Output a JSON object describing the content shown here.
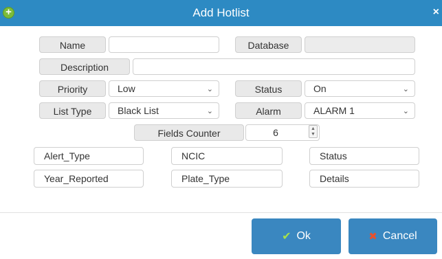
{
  "dialog": {
    "title": "Add Hotlist",
    "add_icon": "plus-circle-icon",
    "close_glyph": "×"
  },
  "form": {
    "name_label": "Name",
    "name_value": "",
    "database_label": "Database",
    "database_value": "",
    "description_label": "Description",
    "description_value": "",
    "priority_label": "Priority",
    "priority_value": "Low",
    "status_label": "Status",
    "status_value": "On",
    "list_type_label": "List Type",
    "list_type_value": "Black List",
    "alarm_label": "Alarm",
    "alarm_value": "ALARM 1",
    "fields_counter_label": "Fields Counter",
    "fields_counter_value": "6"
  },
  "fields": [
    "Alert_Type",
    "NCIC",
    "Status",
    "Year_Reported",
    "Plate_Type",
    "Details"
  ],
  "buttons": {
    "ok_label": "Ok",
    "cancel_label": "Cancel"
  },
  "colors": {
    "titlebar": "#2d8ac3",
    "button": "#3a87c0",
    "ok_check": "#a6e14a",
    "cancel_x": "#e8512d"
  }
}
